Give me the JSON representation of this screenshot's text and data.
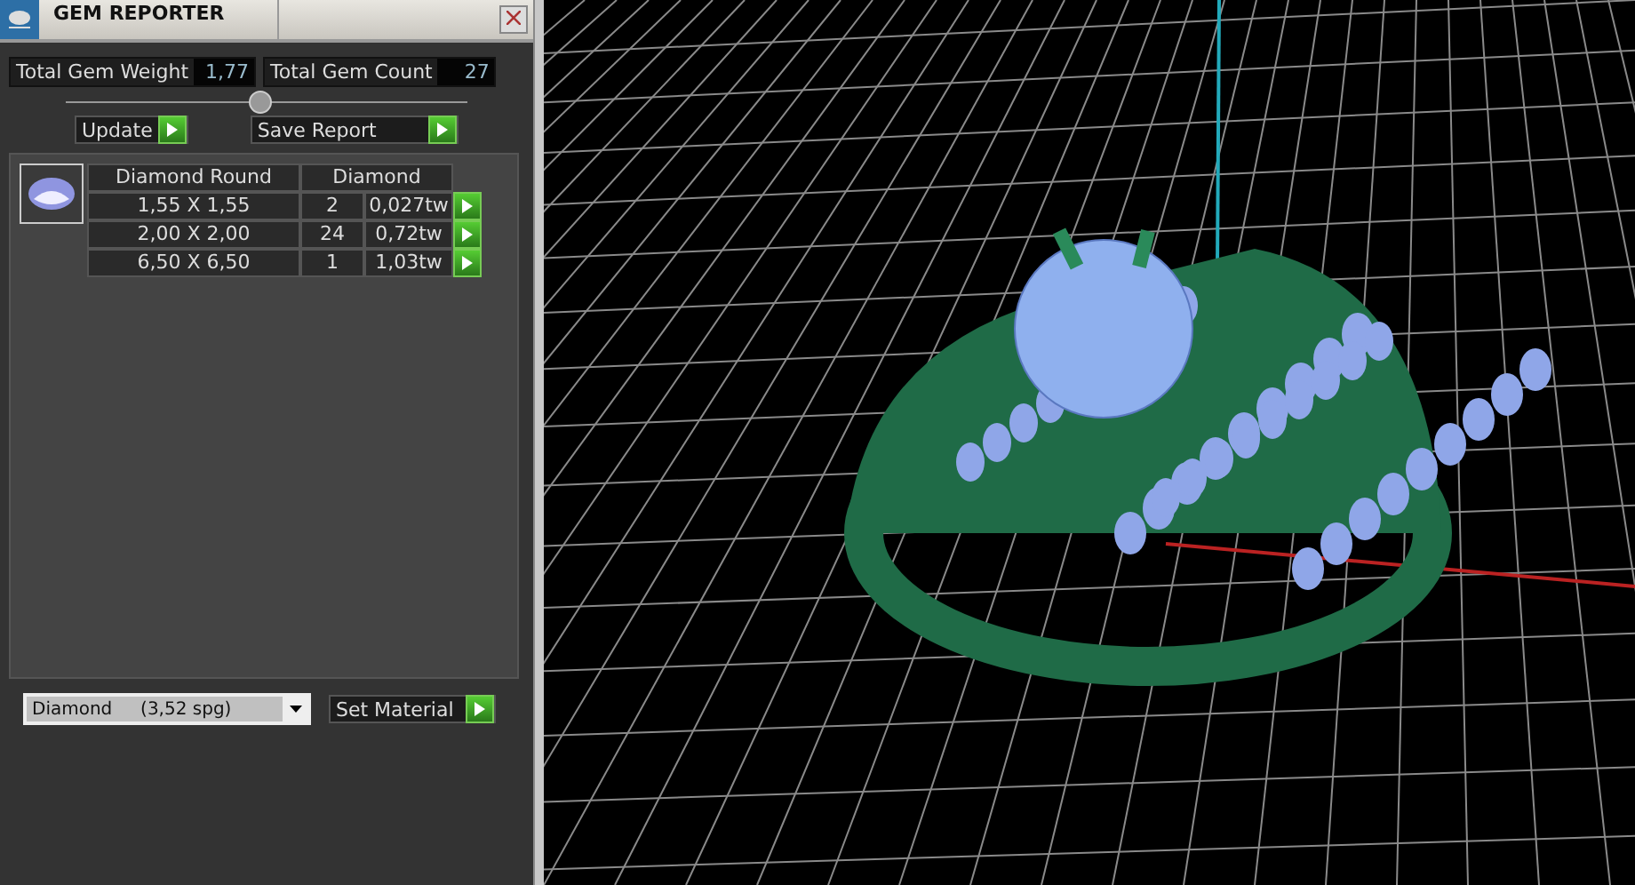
{
  "window": {
    "title": "GEM REPORTER"
  },
  "totals": [
    {
      "label": "Total Gem Weight",
      "value": "1,77"
    },
    {
      "label": "Total Gem Count",
      "value": "27"
    }
  ],
  "buttons": [
    {
      "label": "Update"
    },
    {
      "label": "Save Report"
    }
  ],
  "gem_table": {
    "columns": [
      "Diamond Round",
      "Diamond"
    ],
    "rows": [
      {
        "size": "1,55 X 1,55",
        "count": "2",
        "weight": "0,027tw"
      },
      {
        "size": "2,00 X 2,00",
        "count": "24",
        "weight": "0,72tw"
      },
      {
        "size": "6,50 X 6,50",
        "count": "1",
        "weight": "1,03tw"
      }
    ]
  },
  "material": {
    "value": "Diamond     (3,52 spg)",
    "button": "Set Material"
  }
}
